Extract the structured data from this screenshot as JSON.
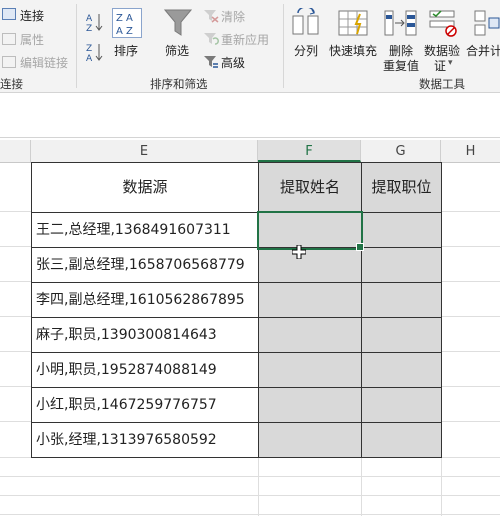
{
  "ribbon": {
    "connections": {
      "refresh_label": "连接",
      "properties_label": "属性",
      "edit_links_label": "编辑链接",
      "group_label": "连接"
    },
    "sort_filter": {
      "sort_label": "排序",
      "filter_label": "筛选",
      "clear_label": "清除",
      "reapply_label": "重新应用",
      "advanced_label": "高级",
      "group_label": "排序和筛选"
    },
    "data_tools": {
      "text_to_columns_label": "分列",
      "flash_fill_label": "快速填充",
      "remove_duplicates_label1": "删除",
      "remove_duplicates_label2": "重复值",
      "data_validation_label1": "数据验",
      "data_validation_label2": "证",
      "consolidate_label": "合并计",
      "group_label": "数据工具"
    }
  },
  "columns": [
    "E",
    "F",
    "G",
    "H"
  ],
  "table": {
    "headers": [
      "数据源",
      "提取姓名",
      "提取职位"
    ],
    "rows": [
      "王二,总经理,1368491607311",
      "张三,副总经理,1658706568779",
      "李四,副总经理,1610562867895",
      "麻子,职员,1390300814643",
      "小明,职员,1952874088149",
      "小红,职员,1467259776757",
      "小张,经理,1313976580592"
    ]
  },
  "colors": {
    "accent": "#217346",
    "filled_cell": "#d9d9d9"
  }
}
